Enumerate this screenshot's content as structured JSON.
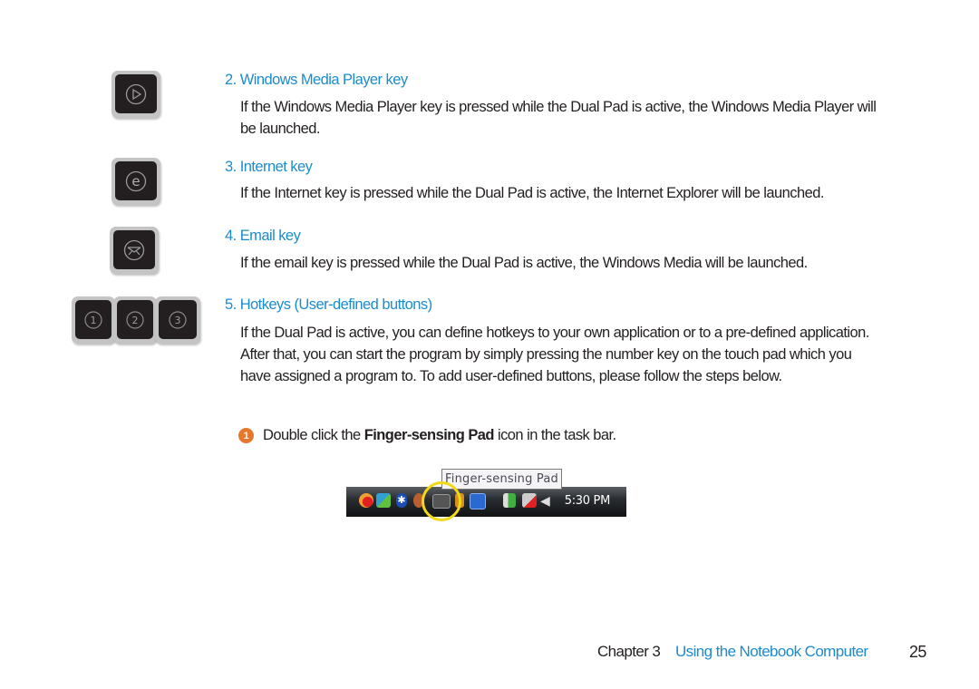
{
  "sections": [
    {
      "heading": "2. Windows Media Player key",
      "body": "If the Windows Media Player key is pressed while the Dual Pad is active, the Windows Media Player will be launched.",
      "key_icon": "play-icon"
    },
    {
      "heading": "3. Internet key",
      "body": "If the Internet key is pressed while the Dual Pad is active, the Internet Explorer will be launched.",
      "key_icon": "internet-explorer-icon"
    },
    {
      "heading": "4. Email key",
      "body": "If the email key is pressed while the Dual Pad is active, the Windows Media will be launched.",
      "key_icon": "email-icon"
    },
    {
      "heading": "5. Hotkeys (User-defined buttons)",
      "body": "If the Dual Pad is active, you can define hotkeys to your own application or to a pre-defined application. After that, you can start the program by simply pressing the number key on the touch pad which you have assigned a program to. To add user-defined buttons, please follow the steps below.",
      "keys": [
        "1",
        "2",
        "3"
      ]
    }
  ],
  "step": {
    "number": "1",
    "before": "Double click the ",
    "bold": "Finger-sensing Pad",
    "after": " icon in the task bar."
  },
  "taskbar": {
    "tooltip": "Finger-sensing Pad",
    "clock": "5:30 PM",
    "highlight_color": "#f2d816"
  },
  "footer": {
    "chapter": "Chapter 3",
    "title": "Using the Notebook Computer",
    "page": "25"
  },
  "colors": {
    "accent": "#1b8ccc",
    "step_badge": "#e8772e",
    "text": "#231f20"
  }
}
